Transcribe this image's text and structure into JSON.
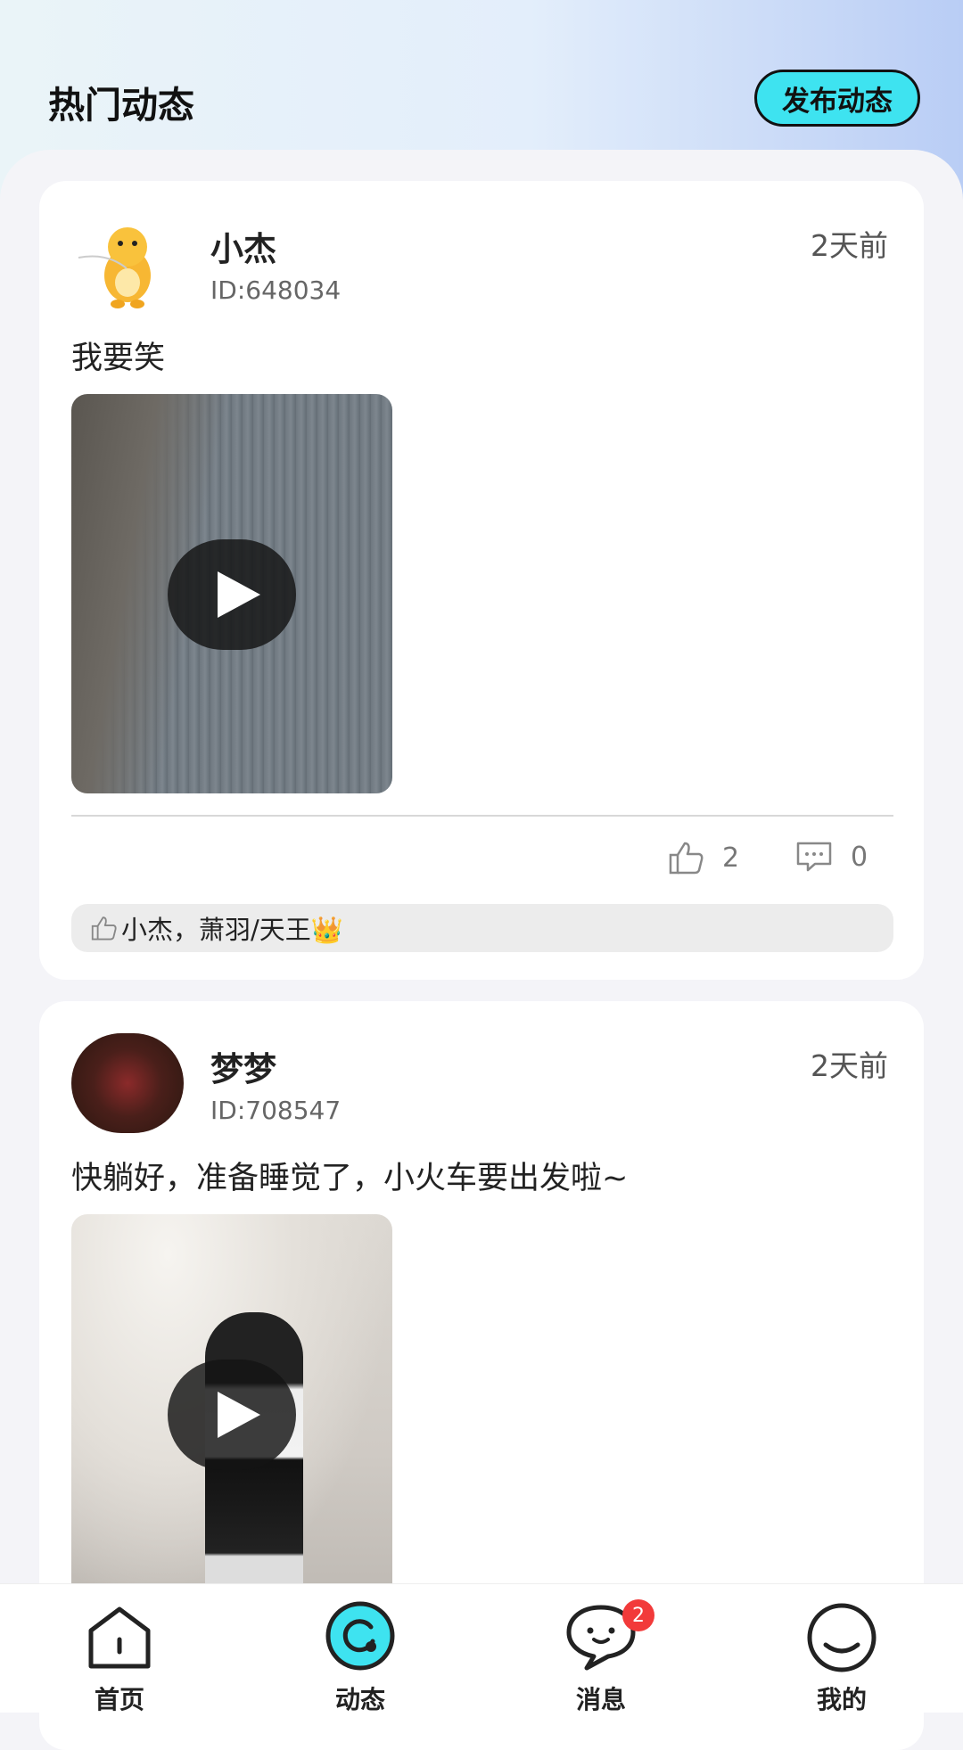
{
  "header": {
    "title": "热门动态",
    "publish_label": "发布动态"
  },
  "posts": [
    {
      "name": "小杰",
      "id_text": "ID:648034",
      "time": "2天前",
      "text": "我要笑",
      "media": "video",
      "likes": "2",
      "comments": "0",
      "likers": "小杰，萧羽/天王👑"
    },
    {
      "name": "梦梦",
      "id_text": "ID:708547",
      "time": "2天前",
      "text": "快躺好，准备睡觉了，小火车要出发啦~",
      "media": "video"
    }
  ],
  "tabbar": {
    "items": [
      {
        "label": "首页",
        "icon": "home-icon"
      },
      {
        "label": "动态",
        "icon": "moments-icon",
        "active": true
      },
      {
        "label": "消息",
        "icon": "message-icon",
        "badge": "2"
      },
      {
        "label": "我的",
        "icon": "profile-icon"
      }
    ]
  },
  "colors": {
    "accent": "#3ee3f0",
    "badge": "#f23a3a"
  }
}
